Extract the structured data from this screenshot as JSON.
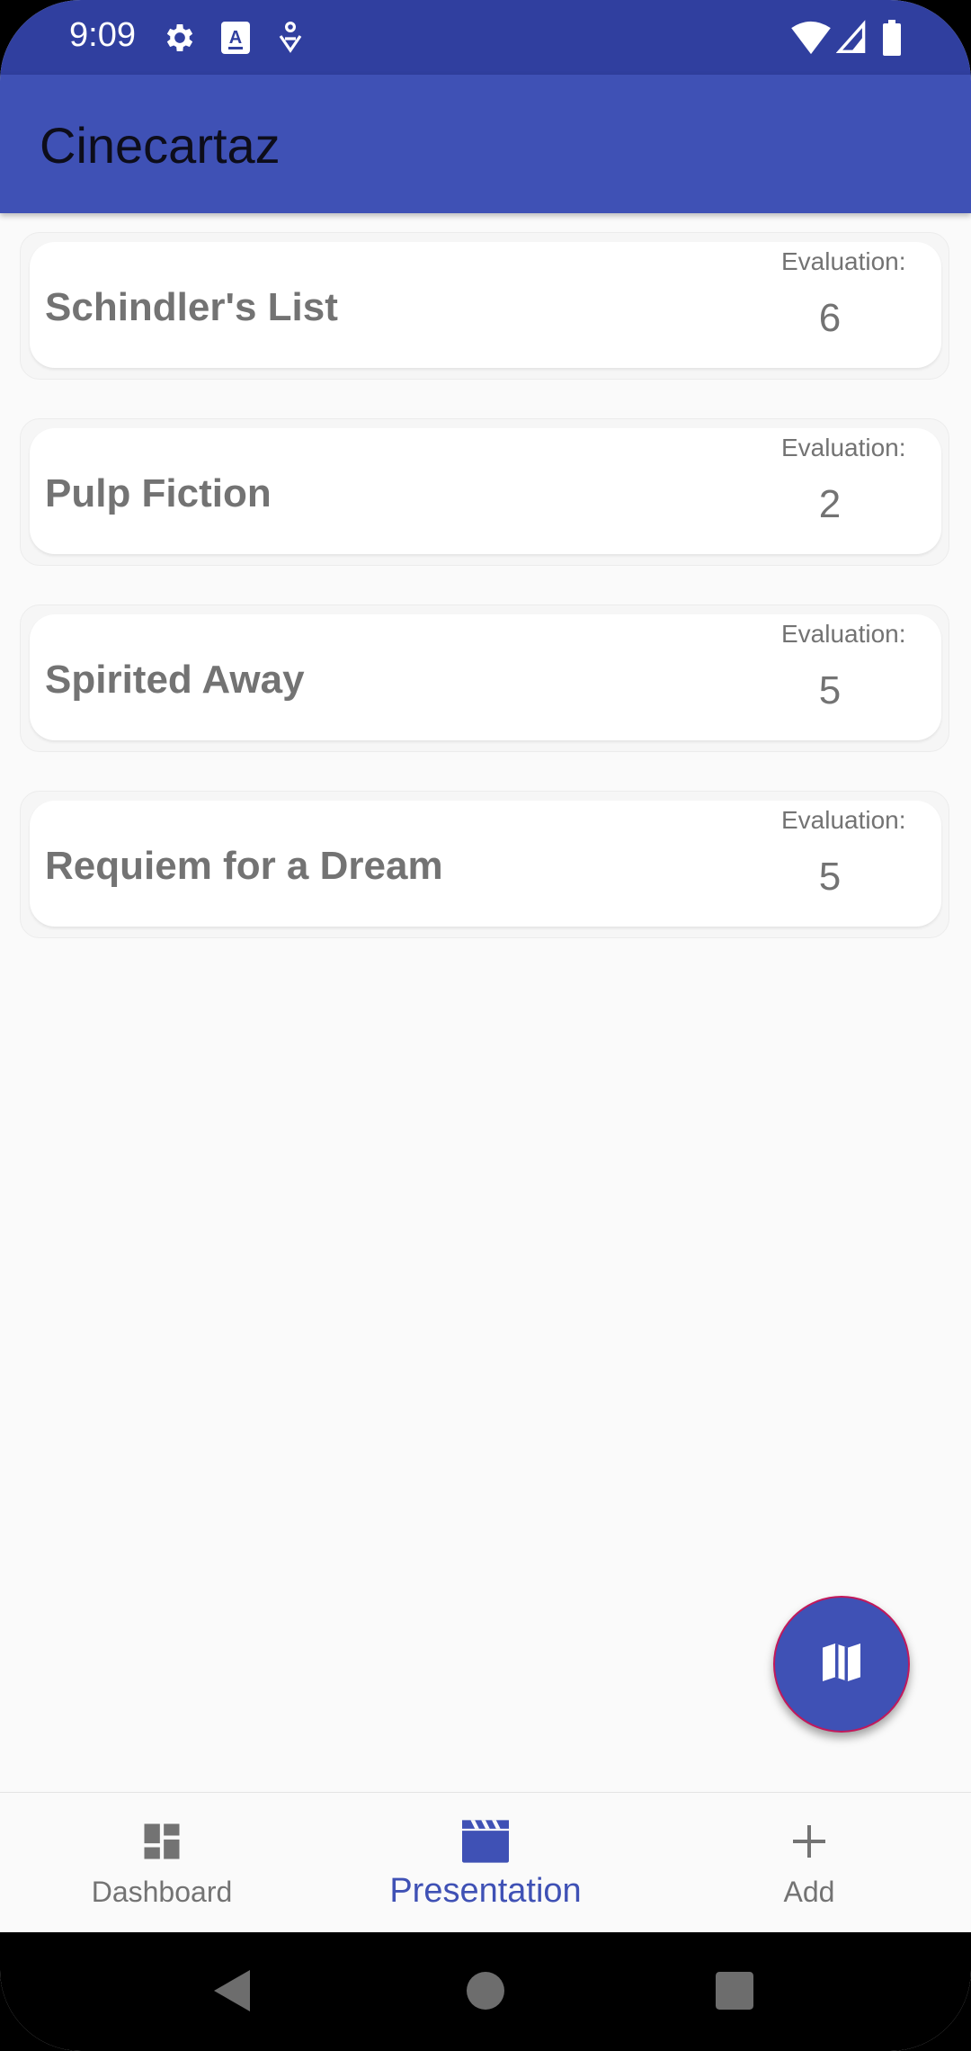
{
  "status_bar": {
    "time": "9:09"
  },
  "app_bar": {
    "title": "Cinecartaz"
  },
  "movies": [
    {
      "title": "Schindler's List",
      "evaluation_label": "Evaluation:",
      "evaluation": "6"
    },
    {
      "title": "Pulp Fiction",
      "evaluation_label": "Evaluation:",
      "evaluation": "2"
    },
    {
      "title": "Spirited Away",
      "evaluation_label": "Evaluation:",
      "evaluation": "5"
    },
    {
      "title": "Requiem for a Dream",
      "evaluation_label": "Evaluation:",
      "evaluation": "5"
    }
  ],
  "fab": {
    "icon": "map-icon"
  },
  "bottom_nav": {
    "items": [
      {
        "label": "Dashboard",
        "icon": "dashboard-icon",
        "active": false
      },
      {
        "label": "Presentation",
        "icon": "movie-clapper-icon",
        "active": true
      },
      {
        "label": "Add",
        "icon": "add-icon",
        "active": false
      }
    ]
  },
  "colors": {
    "primary": "#3f51b5",
    "primary_dark": "#303f9f",
    "text_secondary": "#737373"
  }
}
